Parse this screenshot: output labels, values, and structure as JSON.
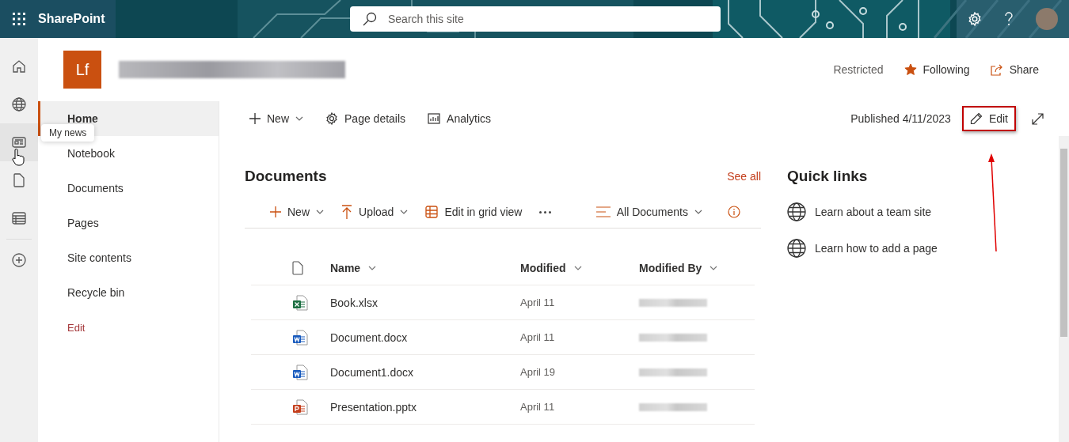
{
  "app_bar": {
    "title": "SharePoint",
    "search": {
      "placeholder": "Search this site"
    }
  },
  "rail": {
    "items": [
      {
        "kind": "home",
        "hovered": false
      },
      {
        "kind": "globe",
        "hovered": false
      },
      {
        "kind": "news",
        "hovered": true
      },
      {
        "kind": "file",
        "hovered": false
      },
      {
        "kind": "list",
        "hovered": false
      },
      {
        "kind": "add",
        "hovered": false
      }
    ],
    "tooltip": "My news"
  },
  "site": {
    "logo": "Lf",
    "status": "Restricted",
    "follow": {
      "label": "Following",
      "following": true
    },
    "share": "Share"
  },
  "nav": [
    {
      "label": "Home",
      "selected": true
    },
    {
      "label": "Notebook",
      "selected": false
    },
    {
      "label": "Documents",
      "selected": false
    },
    {
      "label": "Pages",
      "selected": false
    },
    {
      "label": "Site contents",
      "selected": false
    },
    {
      "label": "Recycle bin",
      "selected": false
    },
    {
      "label": "Edit",
      "selected": false,
      "kind": "link"
    }
  ],
  "command_bar": {
    "items": [
      {
        "kind": "new",
        "label": "New",
        "dropdown": true
      },
      {
        "kind": "details",
        "label": "Page details",
        "dropdown": false
      },
      {
        "kind": "analytics",
        "label": "Analytics",
        "dropdown": false
      }
    ],
    "published": "Published 4/11/2023",
    "edit": "Edit"
  },
  "documents": {
    "title": "Documents",
    "see_all": "See all",
    "toolbar": [
      {
        "kind": "new",
        "label": "New",
        "dropdown": true
      },
      {
        "kind": "upload",
        "label": "Upload",
        "dropdown": true
      },
      {
        "kind": "grid",
        "label": "Edit in grid view",
        "dropdown": false
      }
    ],
    "view": "All Documents",
    "columns": [
      "Name",
      "Modified",
      "Modified By"
    ],
    "rows": [
      {
        "kind": "xlsx",
        "name": "Book.xlsx",
        "modified": "April 11"
      },
      {
        "kind": "docx",
        "name": "Document.docx",
        "modified": "April 11"
      },
      {
        "kind": "docx",
        "name": "Document1.docx",
        "modified": "April 19"
      },
      {
        "kind": "pptx",
        "name": "Presentation.pptx",
        "modified": "April 11"
      }
    ]
  },
  "quick_links": {
    "title": "Quick links",
    "items": [
      "Learn about a team site",
      "Learn how to add a page"
    ]
  }
}
